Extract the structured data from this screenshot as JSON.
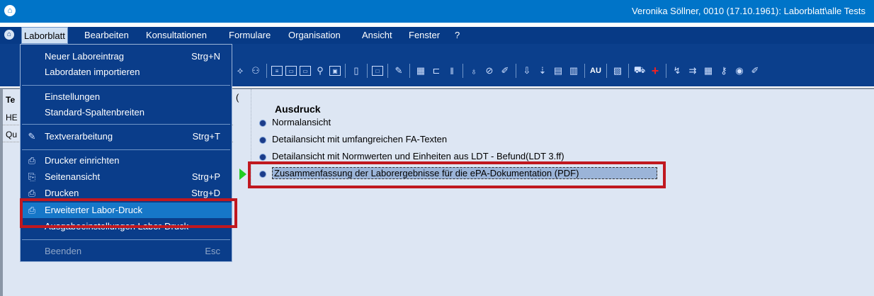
{
  "titlebar": {
    "title": "Veronika Söllner, 0010 (17.10.1961): Laborblatt\\alle Tests"
  },
  "menubar": {
    "items": [
      "Laborblatt",
      "Bearbeiten",
      "Konsultationen",
      "Formulare",
      "Organisation",
      "Ansicht",
      "Fenster",
      "?"
    ],
    "active": "Laborblatt"
  },
  "toolbar": {
    "au_label": "AU"
  },
  "dropdown": {
    "items": [
      {
        "label": "Neuer Laboreintrag",
        "shortcut": "Strg+N",
        "icon": ""
      },
      {
        "label": "Labordaten importieren",
        "shortcut": "",
        "icon": ""
      },
      {
        "label": "Einstellungen",
        "shortcut": "",
        "icon": ""
      },
      {
        "label": "Standard-Spaltenbreiten",
        "shortcut": "",
        "icon": ""
      },
      {
        "label": "Textverarbeitung",
        "shortcut": "Strg+T",
        "icon": "pencil-icon"
      },
      {
        "label": "Drucker einrichten",
        "shortcut": "",
        "icon": "printer-setup-icon"
      },
      {
        "label": "Seitenansicht",
        "shortcut": "Strg+P",
        "icon": "page-preview-icon"
      },
      {
        "label": "Drucken",
        "shortcut": "Strg+D",
        "icon": "printer-icon"
      },
      {
        "label": "Erweiterter Labor-Druck",
        "shortcut": "",
        "icon": "extended-print-icon"
      },
      {
        "label": "Ausgabeeinstellungen Labor-Druck",
        "shortcut": "",
        "icon": ""
      },
      {
        "label": "Beenden",
        "shortcut": "Esc",
        "icon": ""
      }
    ],
    "highlighted": "Erweiterter Labor-Druck"
  },
  "background_fragments": {
    "header_col": "Te",
    "row1": "HE",
    "row2": "Qu",
    "paren": "("
  },
  "print_panel": {
    "title": "Ausdruck",
    "options": [
      "Normalansicht",
      "Detailansicht mit umfangreichen FA-Texten",
      "Detailansicht mit Normwerten und Einheiten aus LDT - Befund(LDT 3.ff)",
      "Zusammenfassung der Laborergebnisse für die ePA-Dokumentation (PDF)"
    ],
    "selected": "Zusammenfassung der Laborergebnisse für die ePA-Dokumentation (PDF)"
  },
  "colors": {
    "titlebar": "#0074c8",
    "menubar": "#073a86",
    "highlight_box": "#c0181f",
    "menu_highlight": "#1677c8"
  }
}
